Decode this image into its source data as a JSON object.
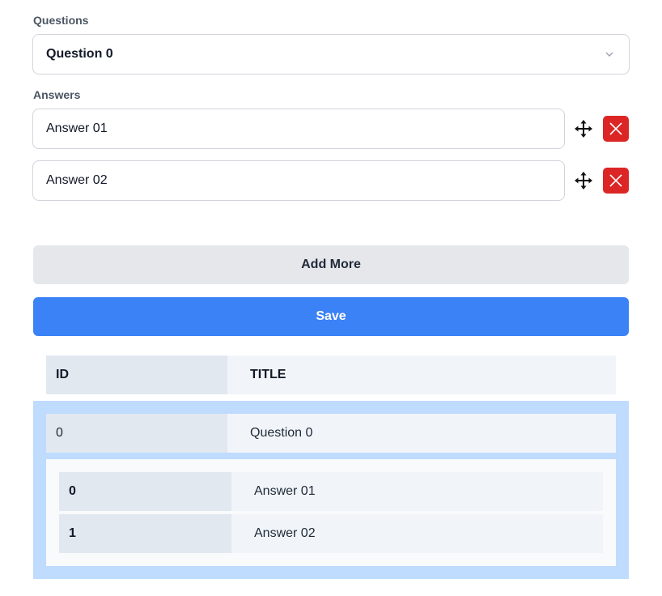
{
  "questions_label": "Questions",
  "selected_question": "Question 0",
  "answers_label": "Answers",
  "answers": [
    {
      "value": "Answer 01"
    },
    {
      "value": "Answer 02"
    }
  ],
  "add_more_label": "Add More",
  "save_label": "Save",
  "table": {
    "headers": {
      "id": "ID",
      "title": "TITLE"
    },
    "row": {
      "id": "0",
      "title": "Question 0"
    },
    "sub_rows": [
      {
        "id": "0",
        "title": "Answer 01"
      },
      {
        "id": "1",
        "title": "Answer 02"
      }
    ]
  },
  "icons": {
    "select_chevron": "chevron-down-icon",
    "move": "move-icon",
    "delete": "close-icon"
  },
  "colors": {
    "primary": "#3b82f6",
    "danger": "#dc2626",
    "secondary": "#e5e7eb",
    "highlight": "#bfdbfe"
  }
}
